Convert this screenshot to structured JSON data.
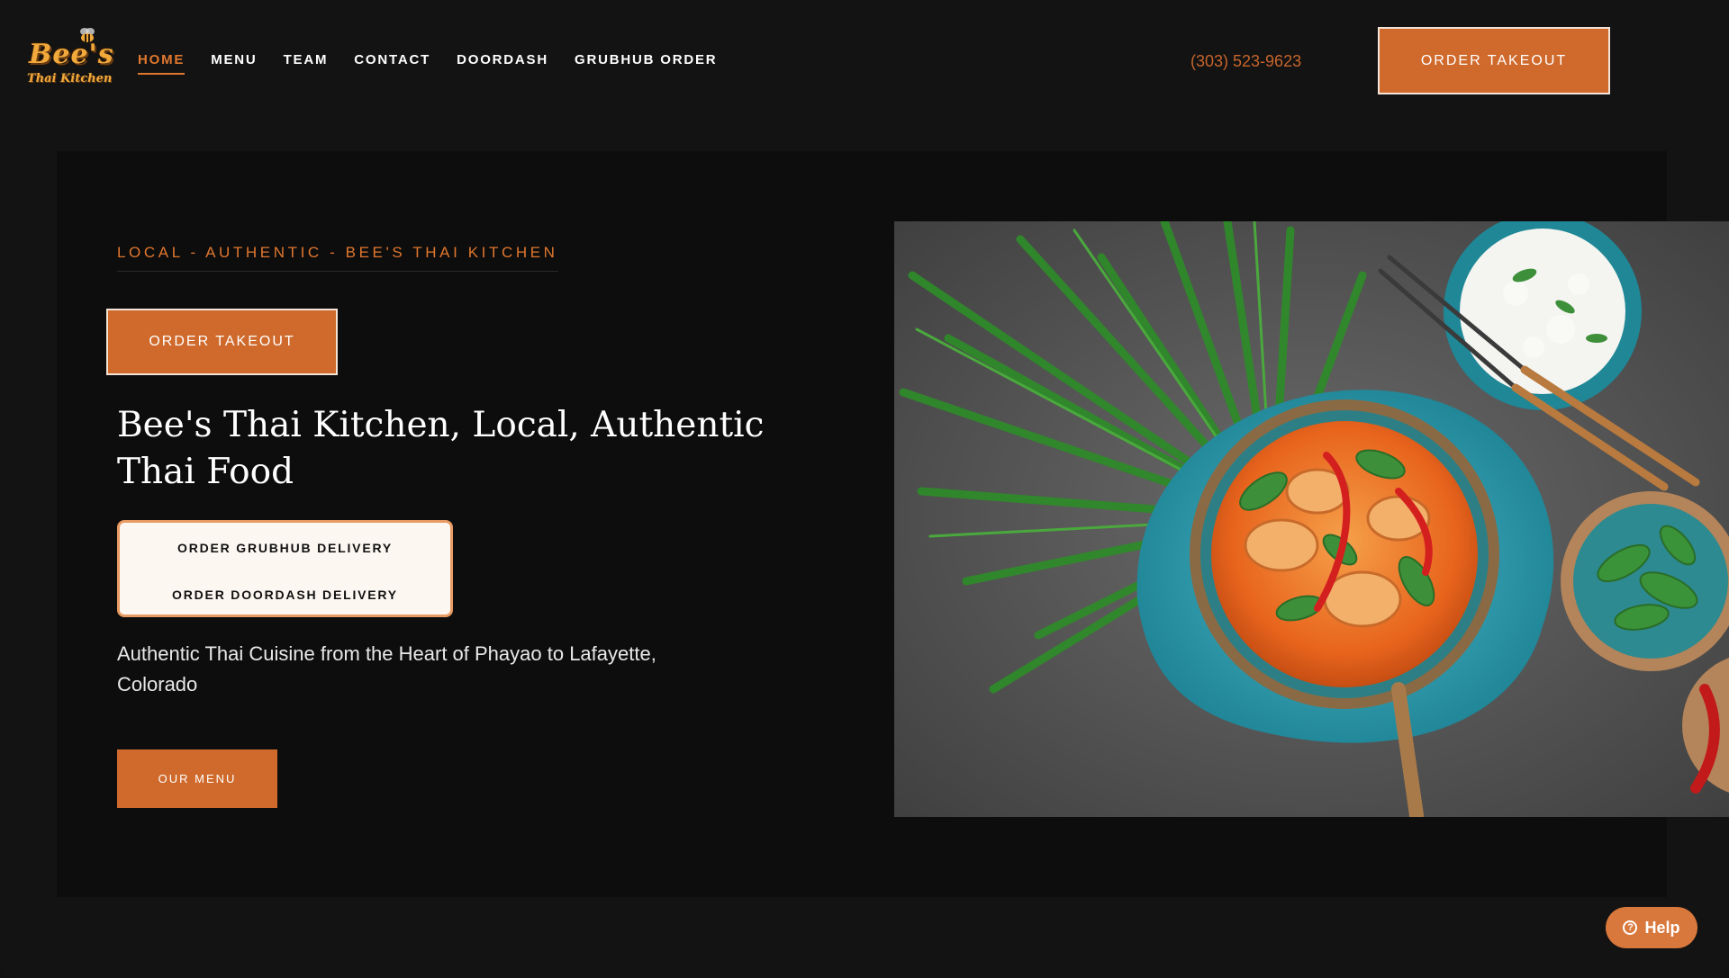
{
  "brand": {
    "logo_line1": "Bee's",
    "logo_line2": "Thai Kitchen",
    "logo_icon": "bee-icon"
  },
  "nav": {
    "items": [
      {
        "label": "HOME",
        "active": true
      },
      {
        "label": "MENU",
        "active": false
      },
      {
        "label": "TEAM",
        "active": false
      },
      {
        "label": "CONTACT",
        "active": false
      },
      {
        "label": "DOORDASH",
        "active": false
      },
      {
        "label": "GRUBHUB ORDER",
        "active": false
      }
    ]
  },
  "header": {
    "phone": "(303) 523-9623",
    "order_button": "ORDER TAKEOUT"
  },
  "hero": {
    "eyebrow": "LOCAL - AUTHENTIC - BEE'S THAI KITCHEN",
    "order_button": "ORDER TAKEOUT",
    "headline": "Bee's Thai Kitchen, Local, Authentic Thai Food",
    "delivery_links": [
      "ORDER GRUBHUB DELIVERY",
      "ORDER DOORDASH DELIVERY"
    ],
    "description": "Authentic Thai Cuisine from the Heart of Phayao to Lafayette, Colorado",
    "menu_button": "OUR MENU"
  },
  "help": {
    "label": "Help",
    "icon": "question-circle-icon"
  },
  "colors": {
    "accent": "#cf6a2c",
    "nav_active": "#e0772e",
    "background": "#131313",
    "hero_background": "#0d0d0d",
    "delivery_box_bg": "#fdf7f2"
  }
}
